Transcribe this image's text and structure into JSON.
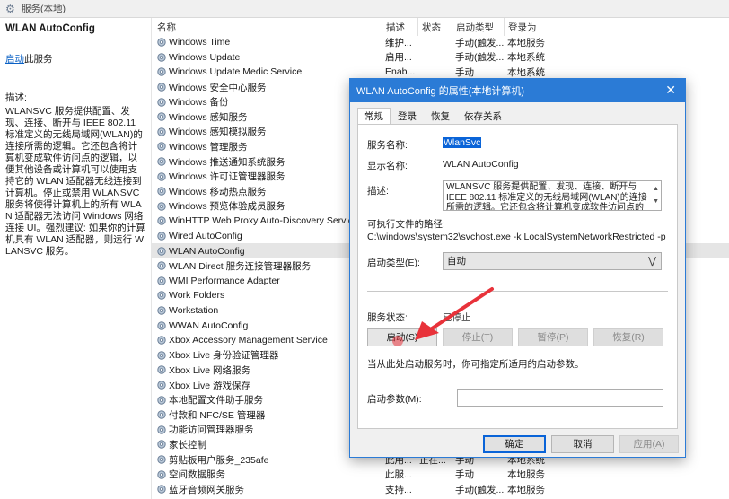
{
  "window": {
    "title": "服务(本地)"
  },
  "left": {
    "service_title": "WLAN AutoConfig",
    "start_link": "启动",
    "start_suffix": "此服务",
    "desc_label": "描述:",
    "desc_text": "WLANSVC 服务提供配置、发现、连接、断开与 IEEE 802.11 标准定义的无线局域网(WLAN)的连接所需的逻辑。它还包含将计算机变成软件访问点的逻辑，以便其他设备或计算机可以使用支持它的 WLAN 适配器无线连接到计算机。停止或禁用 WLANSVC 服务将使得计算机上的所有 WLAN 适配器无法访问 Windows 网络连接 UI。强烈建议: 如果你的计算机具有 WLAN 适配器，则运行 WLANSVC 服务。"
  },
  "list": {
    "headers": {
      "name": "名称",
      "desc": "描述",
      "status": "状态",
      "stype": "启动类型",
      "logon": "登录为"
    },
    "rows": [
      {
        "name": "Windows Time",
        "desc": "维护...",
        "status": "",
        "stype": "手动(触发...",
        "logon": "本地服务"
      },
      {
        "name": "Windows Update",
        "desc": "启用...",
        "status": "",
        "stype": "手动(触发...",
        "logon": "本地系统"
      },
      {
        "name": "Windows Update Medic Service",
        "desc": "Enab...",
        "status": "",
        "stype": "手动",
        "logon": "本地系统"
      },
      {
        "name": "Windows 安全中心服务",
        "desc": "",
        "status": "",
        "stype": "",
        "logon": ""
      },
      {
        "name": "Windows 备份",
        "desc": "",
        "status": "",
        "stype": "",
        "logon": ""
      },
      {
        "name": "Windows 感知服务",
        "desc": "",
        "status": "",
        "stype": "",
        "logon": ""
      },
      {
        "name": "Windows 感知模拟服务",
        "desc": "",
        "status": "",
        "stype": "",
        "logon": ""
      },
      {
        "name": "Windows 管理服务",
        "desc": "",
        "status": "",
        "stype": "",
        "logon": ""
      },
      {
        "name": "Windows 推送通知系统服务",
        "desc": "",
        "status": "",
        "stype": "",
        "logon": ""
      },
      {
        "name": "Windows 许可证管理器服务",
        "desc": "",
        "status": "",
        "stype": "",
        "logon": ""
      },
      {
        "name": "Windows 移动热点服务",
        "desc": "",
        "status": "",
        "stype": "",
        "logon": ""
      },
      {
        "name": "Windows 预览体验成员服务",
        "desc": "",
        "status": "",
        "stype": "",
        "logon": ""
      },
      {
        "name": "WinHTTP Web Proxy Auto-Discovery Service",
        "desc": "",
        "status": "",
        "stype": "",
        "logon": ""
      },
      {
        "name": "Wired AutoConfig",
        "desc": "",
        "status": "",
        "stype": "",
        "logon": ""
      },
      {
        "name": "WLAN AutoConfig",
        "desc": "",
        "status": "",
        "stype": "",
        "logon": "",
        "selected": true
      },
      {
        "name": "WLAN Direct 服务连接管理器服务",
        "desc": "",
        "status": "",
        "stype": "",
        "logon": ""
      },
      {
        "name": "WMI Performance Adapter",
        "desc": "",
        "status": "",
        "stype": "",
        "logon": ""
      },
      {
        "name": "Work Folders",
        "desc": "",
        "status": "",
        "stype": "",
        "logon": ""
      },
      {
        "name": "Workstation",
        "desc": "",
        "status": "",
        "stype": "",
        "logon": ""
      },
      {
        "name": "WWAN AutoConfig",
        "desc": "",
        "status": "",
        "stype": "",
        "logon": ""
      },
      {
        "name": "Xbox Accessory Management Service",
        "desc": "",
        "status": "",
        "stype": "",
        "logon": ""
      },
      {
        "name": "Xbox Live 身份验证管理器",
        "desc": "",
        "status": "",
        "stype": "",
        "logon": ""
      },
      {
        "name": "Xbox Live 网络服务",
        "desc": "",
        "status": "",
        "stype": "",
        "logon": ""
      },
      {
        "name": "Xbox Live 游戏保存",
        "desc": "",
        "status": "",
        "stype": "",
        "logon": ""
      },
      {
        "name": "本地配置文件助手服务",
        "desc": "",
        "status": "",
        "stype": "",
        "logon": ""
      },
      {
        "name": "付款和 NFC/SE 管理器",
        "desc": "",
        "status": "",
        "stype": "",
        "logon": ""
      },
      {
        "name": "功能访问管理器服务",
        "desc": "",
        "status": "",
        "stype": "",
        "logon": ""
      },
      {
        "name": "家长控制",
        "desc": "",
        "status": "",
        "stype": "",
        "logon": ""
      },
      {
        "name": "剪贴板用户服务_235afe",
        "desc": "此用...",
        "status": "正在...",
        "stype": "手动",
        "logon": "本地系统"
      },
      {
        "name": "空间数据服务",
        "desc": "此服...",
        "status": "",
        "stype": "手动",
        "logon": "本地服务"
      },
      {
        "name": "蓝牙音频网关服务",
        "desc": "支持...",
        "status": "",
        "stype": "手动(触发...",
        "logon": "本地服务"
      }
    ]
  },
  "dialog": {
    "title": "WLAN AutoConfig 的属性(本地计算机)",
    "tabs": [
      "常规",
      "登录",
      "恢复",
      "依存关系"
    ],
    "service_name_label": "服务名称:",
    "service_name": "WlanSvc",
    "display_name_label": "显示名称:",
    "display_name": "WLAN AutoConfig",
    "desc_label": "描述:",
    "desc_text": "WLANSVC 服务提供配置、发现、连接、断开与 IEEE 802.11 标准定义的无线局域网(WLAN)的连接所需的逻辑。它还包含将计算机变成软件访问点的逻辑，以便其",
    "path_label": "可执行文件的路径:",
    "path": "C:\\windows\\system32\\svchost.exe -k LocalSystemNetworkRestricted -p",
    "startup_label": "启动类型(E):",
    "startup_value": "自动",
    "status_label": "服务状态:",
    "status_value": "已停止",
    "btn_start": "启动(S)",
    "btn_stop": "停止(T)",
    "btn_pause": "暂停(P)",
    "btn_resume": "恢复(R)",
    "hint": "当从此处启动服务时，你可指定所适用的启动参数。",
    "param_label": "启动参数(M):",
    "param_value": "",
    "btn_ok": "确定",
    "btn_cancel": "取消",
    "btn_apply": "应用(A)"
  },
  "colors": {
    "accent": "#2b7bd6",
    "annotation_arrow": "#e8323a"
  }
}
